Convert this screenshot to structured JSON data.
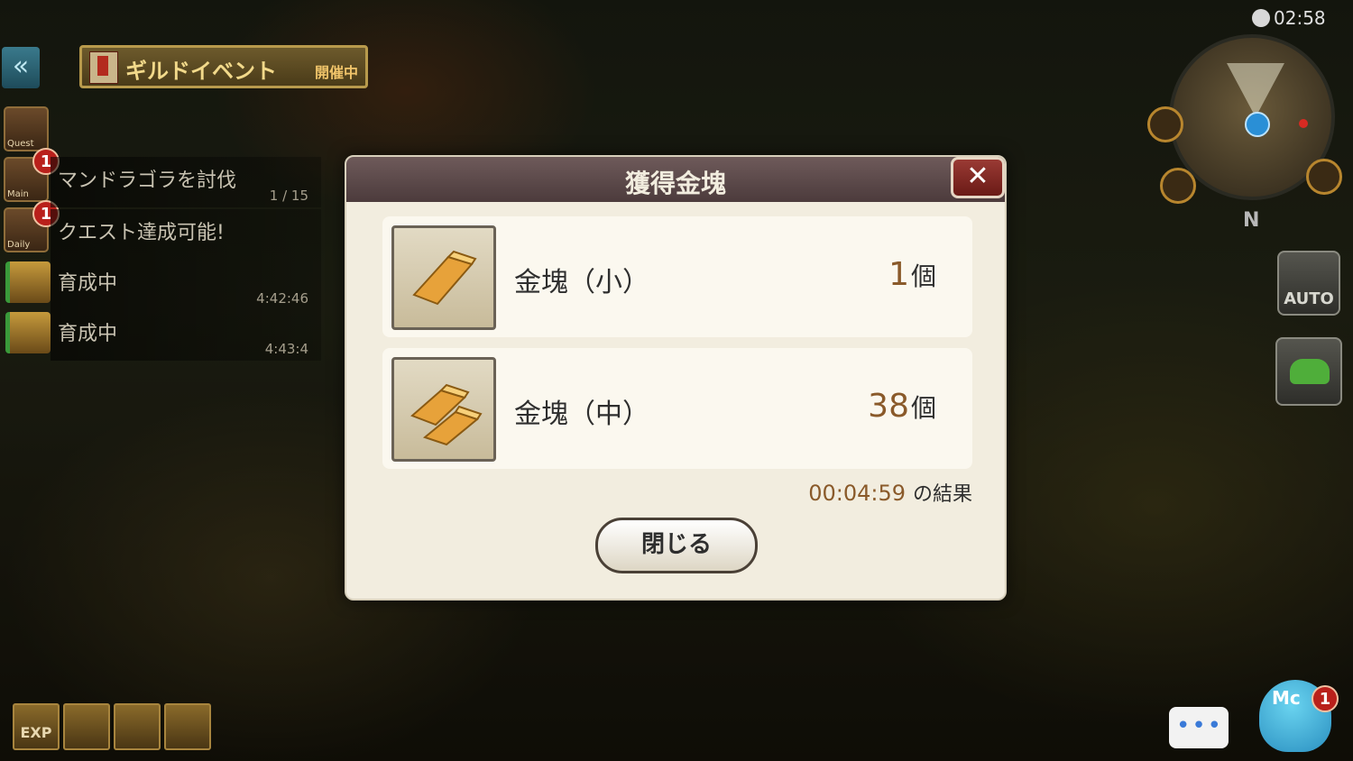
{
  "status_bar": {
    "clock": "02:58"
  },
  "guild_event": {
    "title": "ギルドイベント",
    "status": "開催中"
  },
  "side_icons": [
    {
      "label": "Quest",
      "icon": "quest-book-icon"
    },
    {
      "label": "Main",
      "icon": "main-quest-icon"
    },
    {
      "label": "Daily",
      "icon": "daily-quest-icon"
    }
  ],
  "quests": [
    {
      "text": "マンドラゴラを討伐",
      "progress": "1 / 15",
      "badge": "1"
    },
    {
      "text": "クエスト達成可能!",
      "badge": "1"
    }
  ],
  "training": [
    {
      "text": "育成中",
      "time": "4:42:46"
    },
    {
      "text": "育成中",
      "time": "4:43:4"
    }
  ],
  "minimap": {
    "compass": "N"
  },
  "right_buttons": {
    "auto_label": "AUTO"
  },
  "bottom_bar": {
    "exp_label": "EXP"
  },
  "mascot": {
    "label": "Mc",
    "badge": "1"
  },
  "dialog": {
    "title": "獲得金塊",
    "items": [
      {
        "name": "金塊（小）",
        "count": "1",
        "unit": "個",
        "icon": "gold-bar-small-icon"
      },
      {
        "name": "金塊（中）",
        "count": "38",
        "unit": "個",
        "icon": "gold-bar-medium-icon"
      }
    ],
    "result_time": "00:04:59",
    "result_suffix": "の結果",
    "close_label": "閉じる"
  },
  "colors": {
    "accent": "#8a5a2a",
    "header": "#5a4848",
    "panel": "#f2eddf"
  }
}
